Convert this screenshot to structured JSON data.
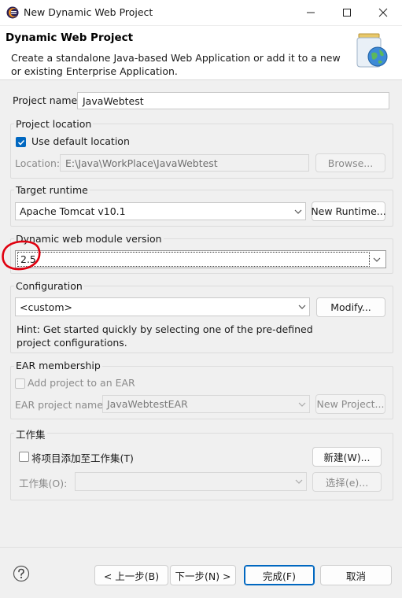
{
  "window": {
    "title": "New Dynamic Web Project"
  },
  "banner": {
    "title": "Dynamic Web Project",
    "description": "Create a standalone Java-based Web Application or add it to a new or existing Enterprise Application."
  },
  "project_name": {
    "label": "Project name:",
    "value": "JavaWebtest"
  },
  "project_location": {
    "group_title": "Project location",
    "use_default_label": "Use default location",
    "use_default_checked": true,
    "location_label": "Location:",
    "location_value": "E:\\Java\\WorkPlace\\JavaWebtest",
    "browse_label": "Browse..."
  },
  "target_runtime": {
    "group_title": "Target runtime",
    "selected": "Apache Tomcat v10.1",
    "new_runtime_label": "New Runtime..."
  },
  "module_version": {
    "group_title": "Dynamic web module version",
    "selected": "2.5"
  },
  "configuration": {
    "group_title": "Configuration",
    "selected": "<custom>",
    "modify_label": "Modify...",
    "hint": "Hint: Get started quickly by selecting one of the pre-defined project configurations."
  },
  "ear": {
    "group_title": "EAR membership",
    "add_label": "Add project to an EAR",
    "add_checked": false,
    "project_name_label": "EAR project name:",
    "project_name_value": "JavaWebtestEAR",
    "new_project_label": "New Project..."
  },
  "working_set": {
    "group_title": "工作集",
    "add_label": "将项目添加至工作集(T)",
    "add_checked": false,
    "new_label": "新建(W)...",
    "set_label": "工作集(O):",
    "select_label": "选择(e)..."
  },
  "footer": {
    "back_label": "< 上一步(B)",
    "next_label": "下一步(N) >",
    "finish_label": "完成(F)",
    "cancel_label": "取消"
  },
  "colors": {
    "accent": "#0067c0",
    "annotation": "#e0000f"
  },
  "icons": {
    "app": "eclipse-icon",
    "banner": "web-project-globe-icon",
    "help": "help-question-icon"
  }
}
